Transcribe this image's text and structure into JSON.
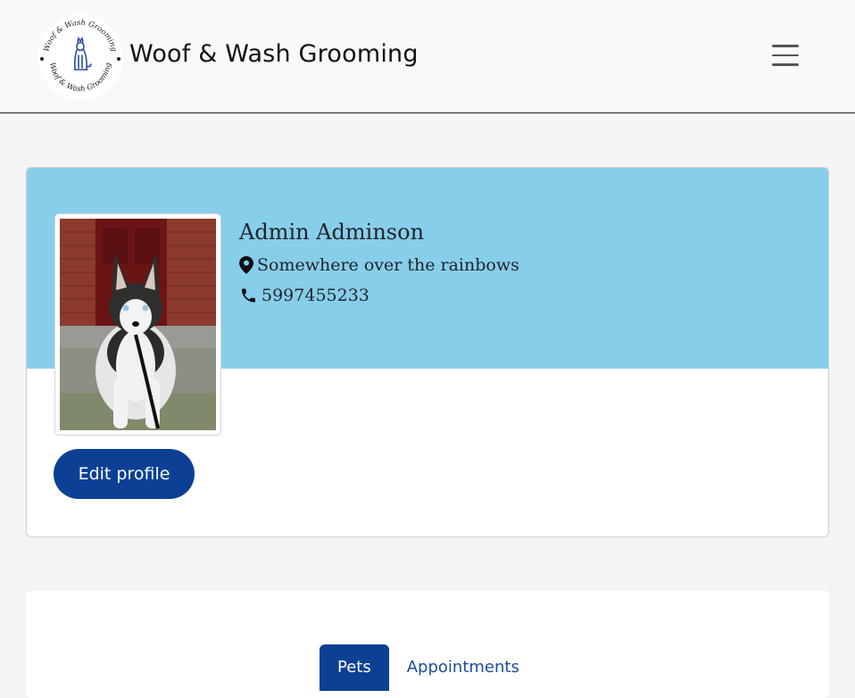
{
  "navbar": {
    "brand_name": "Woof & Wash Grooming",
    "logo_ring_text": "Woof & Wash Grooming",
    "menu_icon": "hamburger-menu-icon"
  },
  "profile": {
    "name": "Admin Adminson",
    "location": "Somewhere over the rainbows",
    "phone": "5997455233",
    "edit_label": "Edit profile",
    "location_icon": "map-pin-icon",
    "phone_icon": "phone-icon"
  },
  "tabs": [
    {
      "label": "Pets",
      "active": true
    },
    {
      "label": "Appointments",
      "active": false
    }
  ],
  "colors": {
    "banner": "#87ceeb",
    "primary": "#0b4095",
    "navbar_bg": "#f8f9fa",
    "page_bg": "#f4f4f4",
    "tab_link": "#1d4f9a"
  }
}
